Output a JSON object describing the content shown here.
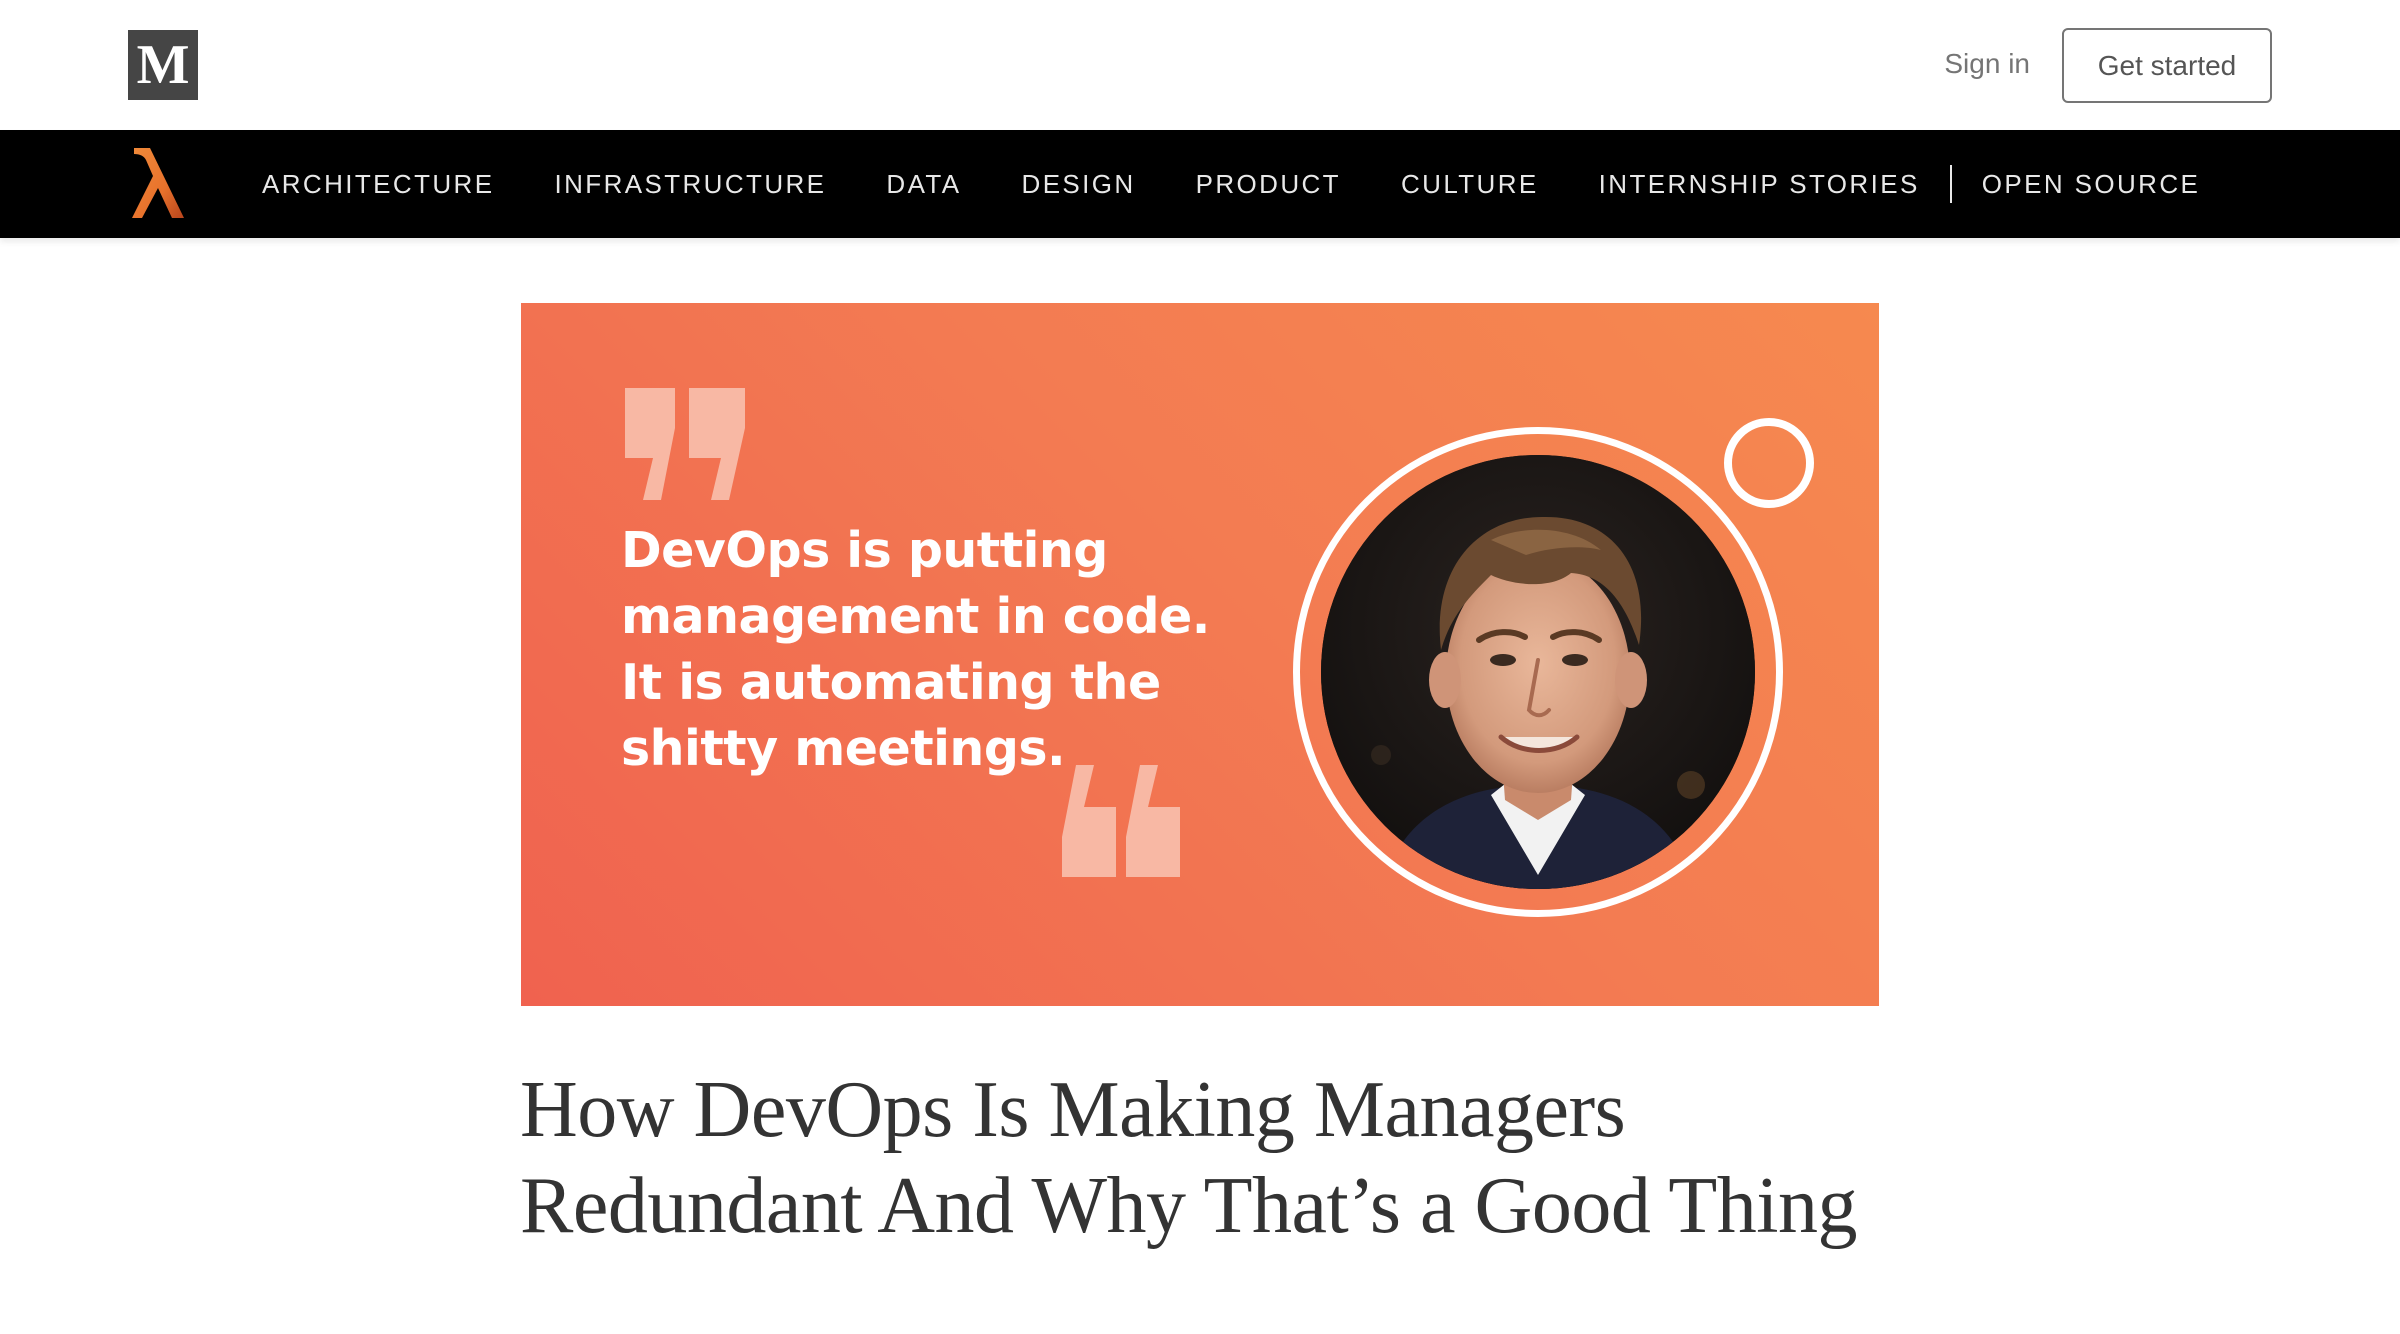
{
  "header": {
    "logo_letter": "M",
    "sign_in_label": "Sign in",
    "get_started_label": "Get started"
  },
  "nav": {
    "items": [
      {
        "label": "ARCHITECTURE"
      },
      {
        "label": "INFRASTRUCTURE"
      },
      {
        "label": "DATA"
      },
      {
        "label": "DESIGN"
      },
      {
        "label": "PRODUCT"
      },
      {
        "label": "CULTURE"
      },
      {
        "label": "INTERNSHIP STORIES"
      },
      {
        "label": "OPEN SOURCE"
      }
    ]
  },
  "hero": {
    "quote_text": "DevOps is putting management in code. It is automating the shitty meetings."
  },
  "article": {
    "title": "How DevOps Is Making Managers Redundant And Why That’s a Good Thing"
  },
  "colors": {
    "navbar": "#000000",
    "hero_gradient_start": "#f0624f",
    "hero_gradient_end": "#f6894f",
    "lambda_logo": "#e8722c",
    "quote_marks": "#f8b8a4"
  },
  "icons": {
    "medium_logo": "medium-logo",
    "brand_logo": "lambda-icon"
  }
}
